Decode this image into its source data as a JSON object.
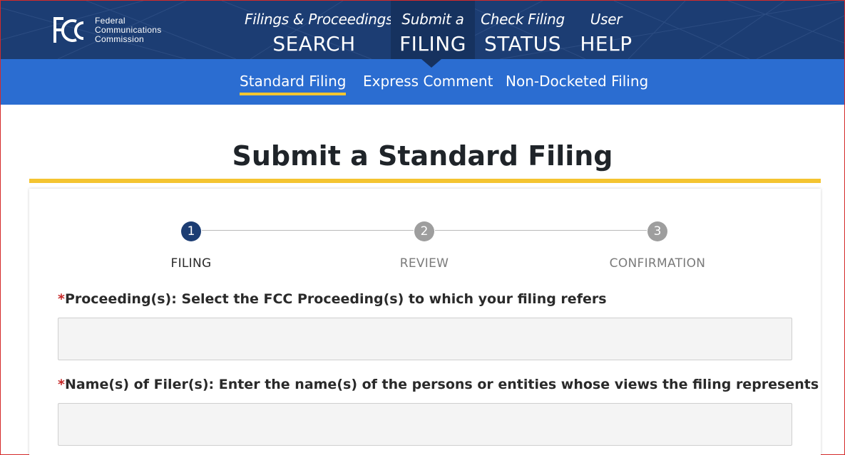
{
  "logo": {
    "abbr": "FCC",
    "line1": "Federal",
    "line2": "Communications",
    "line3": "Commission"
  },
  "mainnav": [
    {
      "small": "Filings & Proceedings",
      "big": "SEARCH"
    },
    {
      "small": "Submit a",
      "big": "FILING"
    },
    {
      "small": "Check Filing",
      "big": "STATUS"
    },
    {
      "small": "User",
      "big": "HELP"
    }
  ],
  "subnav": [
    {
      "label": "Standard Filing"
    },
    {
      "label": "Express Comment"
    },
    {
      "label": "Non-Docketed Filing"
    }
  ],
  "page": {
    "title": "Submit a Standard Filing"
  },
  "steps": [
    {
      "number": "1",
      "label": "FILING"
    },
    {
      "number": "2",
      "label": "REVIEW"
    },
    {
      "number": "3",
      "label": "CONFIRMATION"
    }
  ],
  "form": {
    "required_mark": "*",
    "proceedings_label": "Proceeding(s): Select the FCC Proceeding(s) to which your filing refers",
    "filers_label": "Name(s) of Filer(s): Enter the name(s) of the persons or entities whose views the filing represents"
  },
  "colors": {
    "header": "#1c3d73",
    "subnav": "#2b6dd1",
    "accent": "#f4c430",
    "required": "#c62828"
  }
}
